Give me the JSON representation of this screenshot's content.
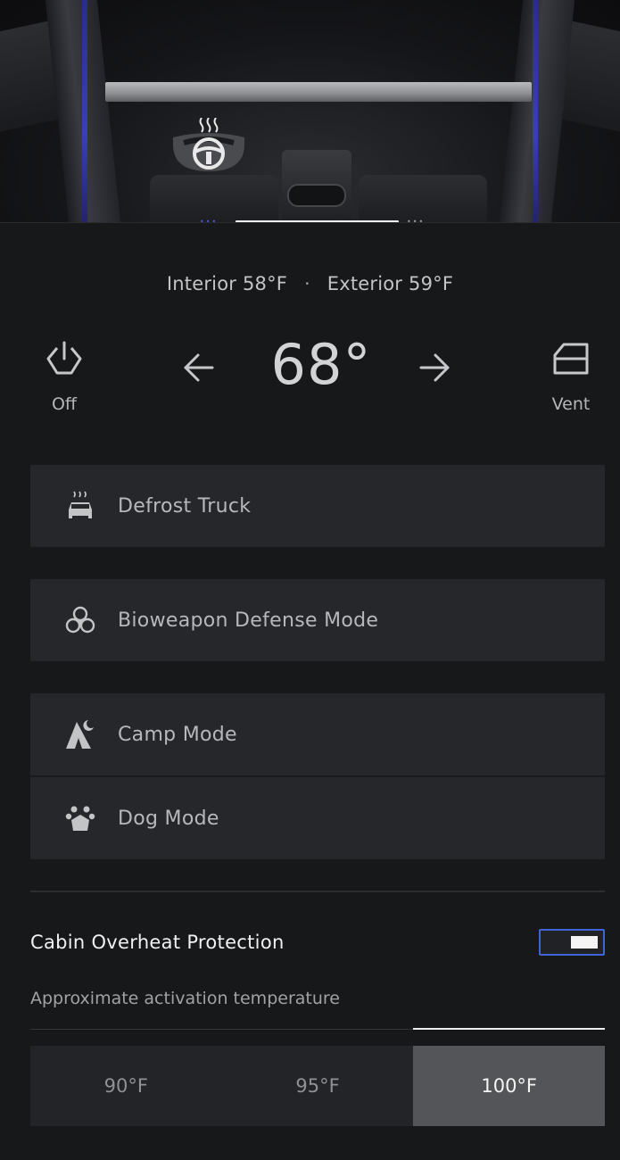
{
  "temperatures": {
    "interior": "Interior 58°F",
    "separator": "·",
    "exterior": "Exterior 59°F"
  },
  "climate": {
    "setpoint": "68°",
    "power_label": "Off",
    "vent_label": "Vent",
    "decrease_icon": "arrow-left-icon",
    "increase_icon": "arrow-right-icon"
  },
  "modes": [
    {
      "label": "Defrost Truck",
      "icon": "defrost-icon"
    },
    {
      "label": "Bioweapon Defense Mode",
      "icon": "biohazard-icon"
    },
    {
      "label": "Camp Mode",
      "icon": "tent-icon"
    },
    {
      "label": "Dog Mode",
      "icon": "paw-icon"
    }
  ],
  "cabin_overheat": {
    "title": "Cabin Overheat Protection",
    "enabled": true,
    "activation_label": "Approximate activation temperature",
    "options": [
      "90°F",
      "95°F",
      "100°F"
    ],
    "selected": "100°F"
  },
  "colors": {
    "background": "#17181a",
    "button_bg": "#26272a",
    "toggle_accent": "#3e64d8",
    "selected_option_bg": "#545558"
  }
}
